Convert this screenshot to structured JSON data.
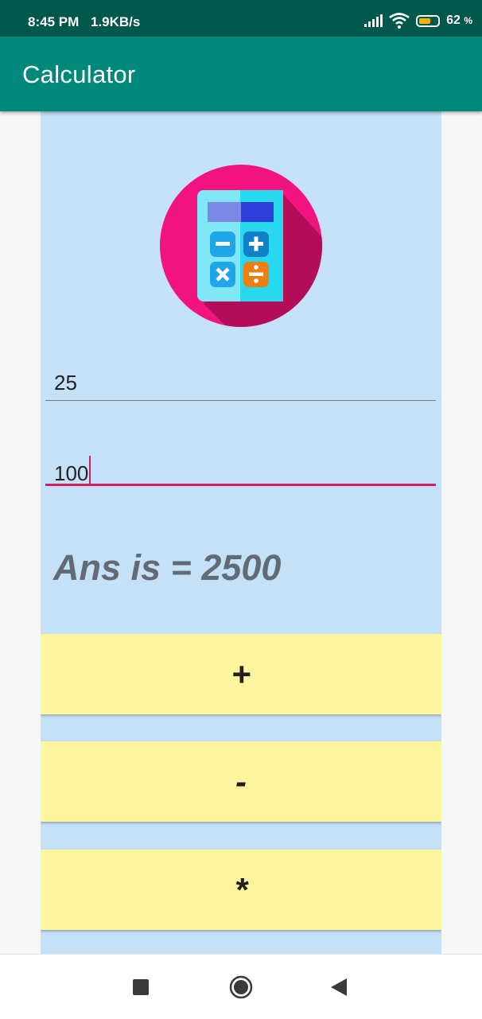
{
  "status_bar": {
    "time": "8:45 PM",
    "speed": "1.9KB/s",
    "battery_level": 62,
    "battery_text": "62",
    "battery_unit": "%"
  },
  "app_bar": {
    "title": "Calculator"
  },
  "inputs": [
    {
      "value": "25"
    },
    {
      "value": "100"
    }
  ],
  "answer": "Ans is = 2500",
  "buttons": [
    {
      "label": "+"
    },
    {
      "label": "-"
    },
    {
      "label": "*"
    }
  ],
  "nav_bar": {
    "items": [
      "recents-icon",
      "home-icon",
      "back-icon"
    ]
  },
  "colors": {
    "status_bar": "#00574b",
    "app_bar": "#00897b",
    "content_bg": "#c5e1f8",
    "button_bg": "#fdf59e",
    "accent": "#d81b60",
    "answer_text": "#626b73"
  }
}
